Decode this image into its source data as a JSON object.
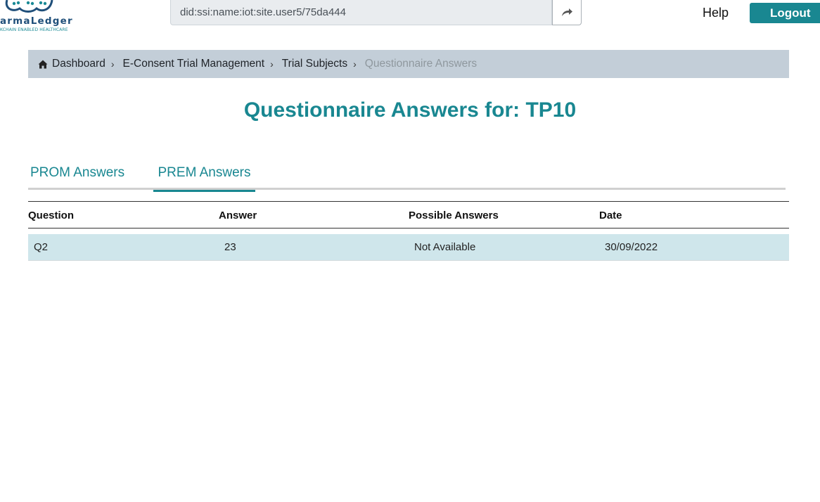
{
  "header": {
    "logo_text": "armaLedger",
    "logo_tagline": "KCHAIN ENABLED HEALTHCARE",
    "did_value": "did:ssi:name:iot:site.user5/75da444",
    "share_icon": "share-arrow-icon",
    "help_label": "Help",
    "logout_label": "Logout"
  },
  "breadcrumb": {
    "items": [
      {
        "label": "Dashboard",
        "icon": "home-icon"
      },
      {
        "label": "E-Consent Trial Management"
      },
      {
        "label": "Trial Subjects"
      },
      {
        "label": "Questionnaire Answers"
      }
    ]
  },
  "page": {
    "title": "Questionnaire Answers for: TP10"
  },
  "tabs": [
    {
      "label": "PROM Answers",
      "active": false
    },
    {
      "label": "PREM Answers",
      "active": true
    }
  ],
  "table": {
    "columns": [
      "Question",
      "Answer",
      "Possible Answers",
      "Date"
    ],
    "rows": [
      [
        "Q2",
        "23",
        "Not Available",
        "30/09/2022"
      ]
    ]
  },
  "colors": {
    "accent": "#198791",
    "breadcrumb_bg": "#c3ced8",
    "row_bg": "#cfe6eb"
  }
}
